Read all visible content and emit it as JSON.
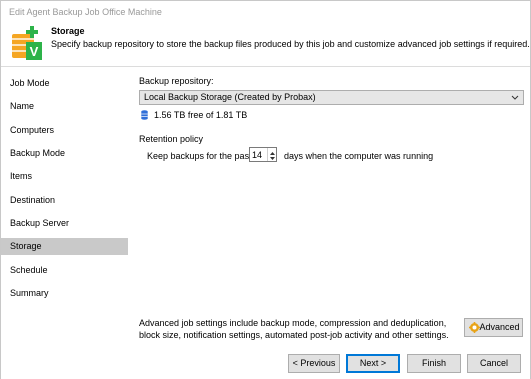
{
  "window": {
    "title": "Edit Agent Backup Job Office Machine"
  },
  "header": {
    "title": "Storage",
    "description": "Specify backup repository to store the backup files produced by this job and customize advanced job settings if required."
  },
  "sidebar": {
    "items": [
      {
        "label": "Job Mode"
      },
      {
        "label": "Name"
      },
      {
        "label": "Computers"
      },
      {
        "label": "Backup Mode"
      },
      {
        "label": "Items"
      },
      {
        "label": "Destination"
      },
      {
        "label": "Backup Server"
      },
      {
        "label": "Storage"
      },
      {
        "label": "Schedule"
      },
      {
        "label": "Summary"
      }
    ],
    "active": "Storage"
  },
  "repository": {
    "label": "Backup repository:",
    "selected": "Local Backup Storage (Created by Probax)",
    "free_space": "1.56 TB free of 1.81 TB"
  },
  "retention": {
    "label": "Retention policy",
    "keep_prefix": "Keep backups for the past:",
    "keep_value": "14",
    "keep_suffix": "days when the computer was running"
  },
  "advanced": {
    "description": "Advanced job settings include backup mode, compression and deduplication, block size, notification settings, automated post-job activity and other settings.",
    "button_label": "Advanced"
  },
  "footer": {
    "previous_label": "< Previous",
    "next_label": "Next >",
    "finish_label": "Finish",
    "cancel_label": "Cancel"
  },
  "colors": {
    "active_nav": "#c9c9c9",
    "content_bg": "#ffffff",
    "accent": "#0078d7",
    "icon_green": "#2db34a",
    "icon_orange": "#f0a030"
  }
}
